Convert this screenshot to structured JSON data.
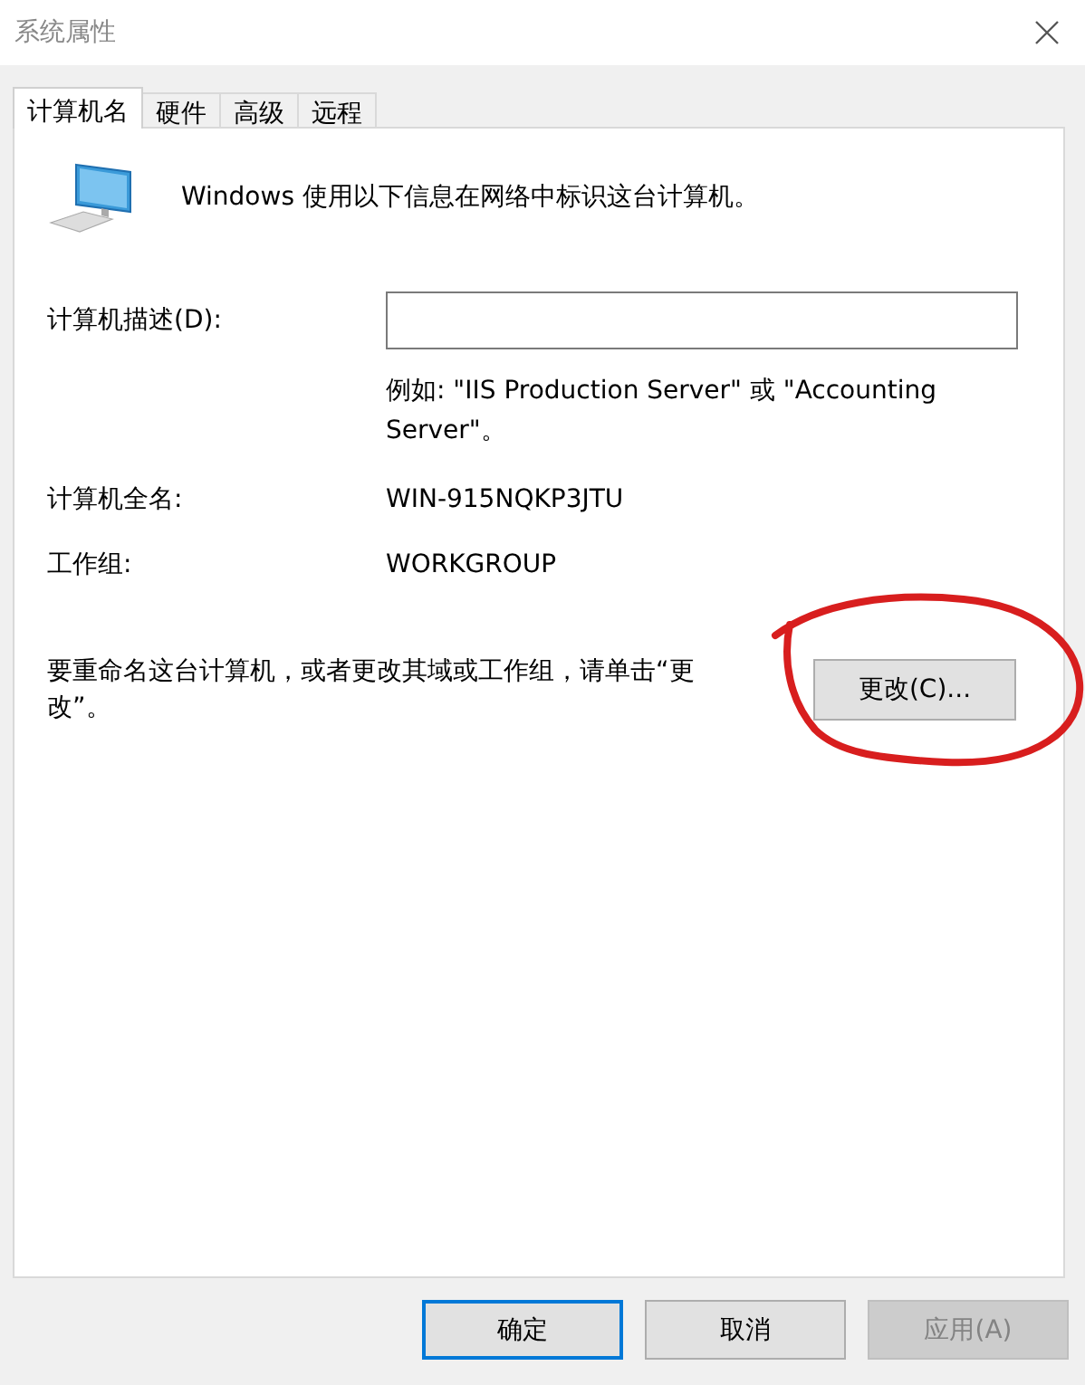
{
  "window": {
    "title": "系统属性"
  },
  "tabs": [
    {
      "label": "计算机名",
      "selected": true
    },
    {
      "label": "硬件",
      "selected": false
    },
    {
      "label": "高级",
      "selected": false
    },
    {
      "label": "远程",
      "selected": false
    }
  ],
  "intro": "Windows 使用以下信息在网络中标识这台计算机。",
  "description": {
    "label": "计算机描述(D):",
    "hint": "例如: \"IIS Production Server\" 或 \"Accounting Server\"。"
  },
  "full_name": {
    "label": "计算机全名:",
    "value": "WIN-915NQKP3JTU"
  },
  "workgroup": {
    "label": "工作组:",
    "value": "WORKGROUP"
  },
  "rename": {
    "text": "要重命名这台计算机，或者更改其域或工作组，请单击“更改”。",
    "button": "更改(C)..."
  },
  "buttons": [
    {
      "label": "确定",
      "default": true,
      "disabled": false
    },
    {
      "label": "取消",
      "default": false,
      "disabled": false
    },
    {
      "label": "应用(A)",
      "default": false,
      "disabled": true
    }
  ]
}
